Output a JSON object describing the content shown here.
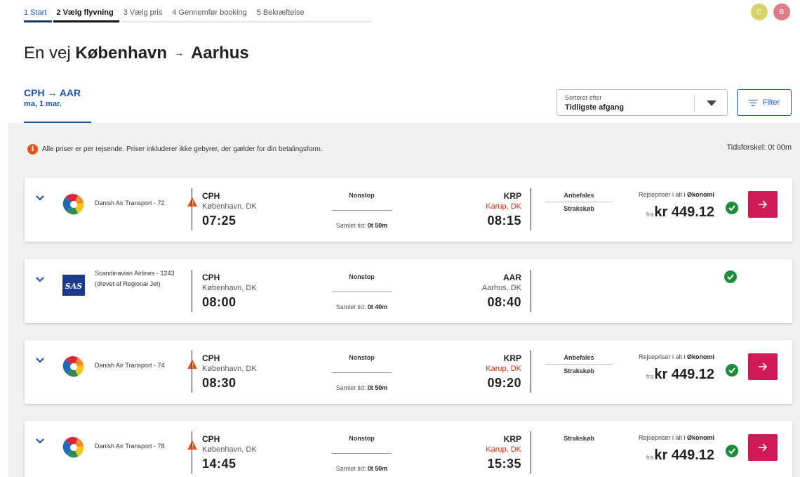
{
  "steps": [
    "1 Start",
    "2 Vælg flyvning",
    "3 Vælg pris",
    "4 Gennemfør booking",
    "5 Bekræftelse"
  ],
  "avatars": [
    "C",
    "B"
  ],
  "title": {
    "prefix": "En vej",
    "origin": "København",
    "arrow": "→",
    "destination": "Aarhus"
  },
  "route_tab": {
    "route": "CPH → AAR",
    "date": "ma, 1 mar."
  },
  "sort": {
    "label": "Sorteret efter",
    "value": "Tidligste afgang"
  },
  "filter_label": "Filter",
  "info_text": "Alle priser er per rejsende. Priser inkluderer ikke gebyrer, der gælder for din betalingsform.",
  "time_difference": "Tidsforskel: 0t 00m",
  "price_label_prefix": "Rejsepriser i alt i",
  "price_label_class": "Økonomi",
  "price_from": "fra",
  "colors": {
    "accent": "#1a56b8",
    "action": "#cf1a57",
    "check": "#1e8b3a",
    "warning": "#e8531c",
    "alt_city": "#d0311a"
  },
  "flights": [
    {
      "airline": "Danish Air Transport - 72",
      "logo": "dat-logo-icon",
      "warning": true,
      "from_code": "CPH",
      "from_city": "København, DK",
      "dep_time": "07:25",
      "stops": "Nonstop",
      "total_label": "Samlet tid:",
      "duration": "0t 50m",
      "to_code": "KRP",
      "to_city": "Karup, DK",
      "to_city_alt": true,
      "arr_time": "08:15",
      "badge1": "Anbefales",
      "badge2": "Strakskøb",
      "price": "kr 449.12"
    },
    {
      "airline": "Scandinavian Airlines - 1243 (drevet af Regional Jet)",
      "logo": "sas-logo-icon",
      "warning": false,
      "from_code": "CPH",
      "from_city": "København, DK",
      "dep_time": "08:00",
      "stops": "Nonstop",
      "total_label": "Samlet tid:",
      "duration": "0t 40m",
      "to_code": "AAR",
      "to_city": "Aarhus, DK",
      "to_city_alt": false,
      "arr_time": "08:40"
    },
    {
      "airline": "Danish Air Transport - 74",
      "logo": "dat-logo-icon",
      "warning": true,
      "from_code": "CPH",
      "from_city": "København, DK",
      "dep_time": "08:30",
      "stops": "Nonstop",
      "total_label": "Samlet tid:",
      "duration": "0t 50m",
      "to_code": "KRP",
      "to_city": "Karup, DK",
      "to_city_alt": true,
      "arr_time": "09:20",
      "badge1": "Anbefales",
      "badge2": "Strakskøb",
      "price": "kr 449.12"
    },
    {
      "airline": "Danish Air Transport - 78",
      "logo": "dat-logo-icon",
      "warning": true,
      "from_code": "CPH",
      "from_city": "København, DK",
      "dep_time": "14:45",
      "stops": "Nonstop",
      "total_label": "Samlet tid:",
      "duration": "0t 50m",
      "to_code": "KRP",
      "to_city": "Karup, DK",
      "to_city_alt": true,
      "arr_time": "15:35",
      "badge1": "Strakskøb",
      "price": "kr 449.12"
    }
  ]
}
